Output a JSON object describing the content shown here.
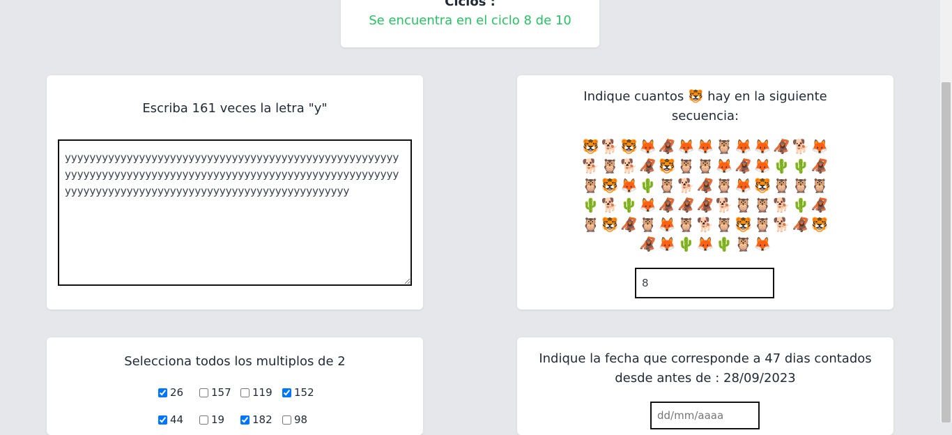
{
  "cycles": {
    "heading": "Ciclos :",
    "status": "Se encuentra en el ciclo 8 de 10",
    "status_color": "#22c55e"
  },
  "letter_task": {
    "title": "Escriba 161 veces la letra \"y\"",
    "value": "yyyyyyyyyyyyyyyyyyyyyyyyyyyyyyyyyyyyyyyyyyyyyyyyyyyyyyyyyyyyyyyyyyyyyyyyyyyyyyyyyyyyyyyyyyyyyyyyyyyyyyyyyyyyyyyyyyyyyyyyyyyyyyyyyyyyyyyyyyyyyyyyyyyyyyyyyy"
  },
  "count_task": {
    "title_before": "Indique cuantos ",
    "title_emoji": "🐯",
    "title_after": " hay en la siguiente secuencia:",
    "sequence": [
      "🐯",
      "🐕",
      "🐯",
      "🦊",
      "🦧",
      "🦊",
      "🦊",
      "🦉",
      "🦊",
      "🦊",
      "🦧",
      "🐕",
      "🦊",
      "🐕",
      "🦉",
      "🐕",
      "🦧",
      "🐯",
      "🦉",
      "🦉",
      "🦊",
      "🦧",
      "🦊",
      "🌵",
      "🌵",
      "🦧",
      "🦉",
      "🐯",
      "🦊",
      "🌵",
      "🦉",
      "🐕",
      "🦧",
      "🦉",
      "🦊",
      "🐯",
      "🦉",
      "🦉",
      "🦉",
      "🌵",
      "🐕",
      "🌵",
      "🦊",
      "🦧",
      "🦧",
      "🦧",
      "🐕",
      "🦉",
      "🦉",
      "🐕",
      "🌵",
      "🦧",
      "🦉",
      "🐯",
      "🦧",
      "🦉",
      "🦊",
      "🦉",
      "🐕",
      "🦉",
      "🐯",
      "🦉",
      "🐕",
      "🦧",
      "🐯",
      "🦧",
      "🦊",
      "🌵",
      "🦊",
      "🌵",
      "🦉",
      "🦊"
    ],
    "answer": "8"
  },
  "multiples_task": {
    "title": "Selecciona todos los multiplos de 2",
    "options": [
      {
        "label": "26",
        "checked": true
      },
      {
        "label": "157",
        "checked": false
      },
      {
        "label": "119",
        "checked": false
      },
      {
        "label": "152",
        "checked": true
      },
      {
        "label": "44",
        "checked": true
      },
      {
        "label": "19",
        "checked": false
      },
      {
        "label": "182",
        "checked": true
      },
      {
        "label": "98",
        "checked": false
      }
    ]
  },
  "date_task": {
    "title": "Indique la fecha que corresponde a 47 dias contados desde antes de : 28/09/2023",
    "placeholder": "dd/mm/aaaa"
  }
}
